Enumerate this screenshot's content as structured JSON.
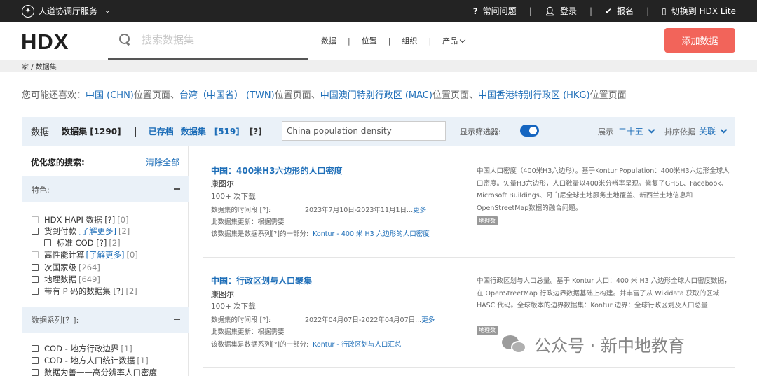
{
  "topbar": {
    "site_name": "人道协调厅服务",
    "faq": "常问问题",
    "login": "登录",
    "signup": "报名",
    "lite": "切换到 HDX Lite"
  },
  "header": {
    "logo": "HDX",
    "search_placeholder": "搜索数据集",
    "nav": [
      "数据",
      "位置",
      "组织",
      "产品"
    ],
    "add_data": "添加数据"
  },
  "breadcrumb": "家 / 数据集",
  "suggestions": {
    "prefix": "您可能还喜欢：",
    "items": [
      {
        "link": "中国 (CHN)",
        "suffix": "位置页面、"
      },
      {
        "link": "台湾（中国省） (TWN)",
        "suffix": "位置页面、"
      },
      {
        "link": "中国澳门特别行政区 (MAC)",
        "suffix": "位置页面、"
      },
      {
        "link": "中国香港特别行政区 (HKG)",
        "suffix": "位置页面"
      }
    ]
  },
  "filterbar": {
    "data": "数据",
    "datasets": "数据集 [1290]",
    "separator": "|",
    "saved": "已存档",
    "saved_datasets": "数据集",
    "saved_count": "[519]",
    "help": "[?]",
    "query": "China population density",
    "show_filters": "显示筛选器:",
    "show_filters_on": true,
    "display_label": "展示",
    "display_value": "二十五",
    "sort_label": "排序依据",
    "sort_value": "关联"
  },
  "sidebar": {
    "heading": "优化您的搜索:",
    "clear_all": "清除全部",
    "panels": [
      {
        "title": "特色:",
        "items": [
          {
            "label": "HDX HAPI 数据 [?]",
            "count": "[0]",
            "dim": true
          },
          {
            "label": "货到付款",
            "more": "[了解更多]",
            "count": "[2]"
          },
          {
            "label": "标准 COD [?]",
            "count": "[2]",
            "indent": true
          },
          {
            "label": "高性能计算",
            "more": "[了解更多]",
            "count": "[0]",
            "dim": true
          },
          {
            "label": "次国家级",
            "count": "[264]"
          },
          {
            "label": "地理数据",
            "count": "[649]"
          },
          {
            "label": "带有 P 码的数据集 [?]",
            "count": "[2]"
          }
        ]
      },
      {
        "title": "数据系列[？]:",
        "items": [
          {
            "label": "COD - 地方行政边界",
            "count": "[1]"
          },
          {
            "label": "COD - 地方人口统计数据",
            "count": "[1]"
          },
          {
            "label": "数据为善——高分辨率人口密度",
            "count": ""
          }
        ]
      }
    ]
  },
  "results": [
    {
      "title": "中国：400米H3六边形的人口密度",
      "org": "康图尔",
      "downloads": "100+ 次下载",
      "time_label": "数据集的时间段",
      "time_help": "[?]:",
      "time_value": "2023年7月10日-2023年11月1日...",
      "more": "更多",
      "update_label": "此数据集更新：根据需要",
      "series_label": "该数据集是数据系列[?]的一部分:",
      "series_link": "Kontur - 400 米 H3 六边形的人口密度",
      "description": "中国人口密度（400米H3六边形）。基于Kontur Population：400米H3六边形全球人口密度。矢量H3六边形，人口数量以400米分辨率呈现。修复了GHSL、Facebook、Microsoft Buildings、哥白尼全球土地服务土地覆盖、新西兰土地信息和OpenStreetMap数据的融合问题。",
      "tag": "地理数"
    },
    {
      "title": "中国：行政区划与人口聚集",
      "org": "康图尔",
      "downloads": "100+ 次下载",
      "time_label": "数据集的时间段",
      "time_help": "[?]:",
      "time_value": "2022年04月07日-2022年04月07日...",
      "more": "更多",
      "update_label": "此数据集更新：根据需要",
      "series_label": "该数据集是数据系列[?]的一部分:",
      "series_link": "Kontur - 行政区划与人口汇总",
      "description": "中国行政区划与人口总量。基于 Kontur 人口：400 米 H3 六边形全球人口密度数据，在 OpenStreetMap 行政边界数据基础上构建。并丰富了从 Wikidata 获取的区域 HASC 代码。全球版本的边界数据集：Kontur 边界：全球行政区划及人口总量",
      "tag": "地理数"
    }
  ],
  "watermark": "公众号 · 新中地教育"
}
